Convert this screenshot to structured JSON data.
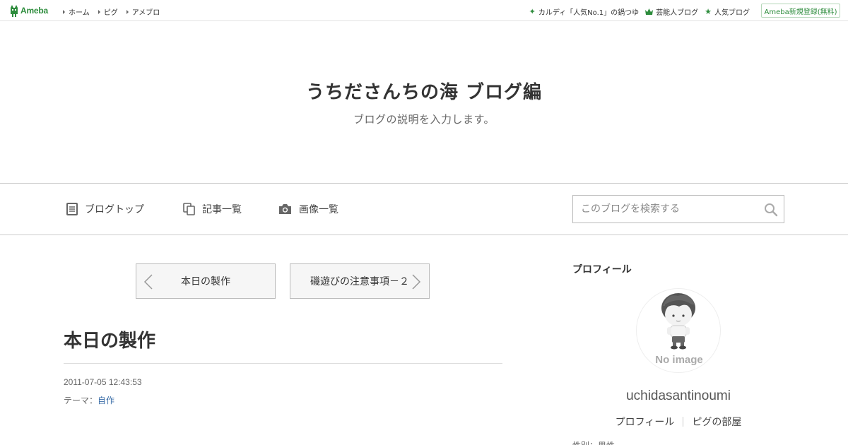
{
  "global_header": {
    "logo_text": "Ameba",
    "nav": [
      {
        "label": "ホーム"
      },
      {
        "label": "ピグ"
      },
      {
        "label": "アメブロ"
      }
    ],
    "right_links": [
      {
        "icon": "sparkle-icon",
        "label": "カルディ「人気No.1」の鍋つゆ"
      },
      {
        "icon": "crown-icon",
        "label": "芸能人ブログ"
      },
      {
        "icon": "star-icon",
        "label": "人気ブログ"
      }
    ],
    "register_label": "Ameba新規登録(無料)"
  },
  "blog": {
    "title": "うちださんちの海 ブログ編",
    "description": "ブログの説明を入力します。"
  },
  "blog_nav": {
    "items": [
      {
        "icon": "document-icon",
        "label": "ブログトップ"
      },
      {
        "icon": "copy-icon",
        "label": "記事一覧"
      },
      {
        "icon": "camera-icon",
        "label": "画像一覧"
      }
    ],
    "search_placeholder": "このブログを検索する"
  },
  "pager": {
    "prev_label": "本日の製作",
    "next_label": "磯遊びの注意事項－２"
  },
  "entry": {
    "title": "本日の製作",
    "date": "2011-07-05 12:43:53",
    "theme_prefix": "テーマ：",
    "theme_link": "自作"
  },
  "sidebar": {
    "heading": "プロフィール",
    "avatar_caption": "No image",
    "user_name": "uchidasantinoumi",
    "links": [
      {
        "label": "プロフィール"
      },
      {
        "label": "ピグの部屋"
      }
    ],
    "cut_text": "性別：男性"
  },
  "colors": {
    "brand_green": "#2d8c3c",
    "link_blue": "#3b6ea8"
  }
}
